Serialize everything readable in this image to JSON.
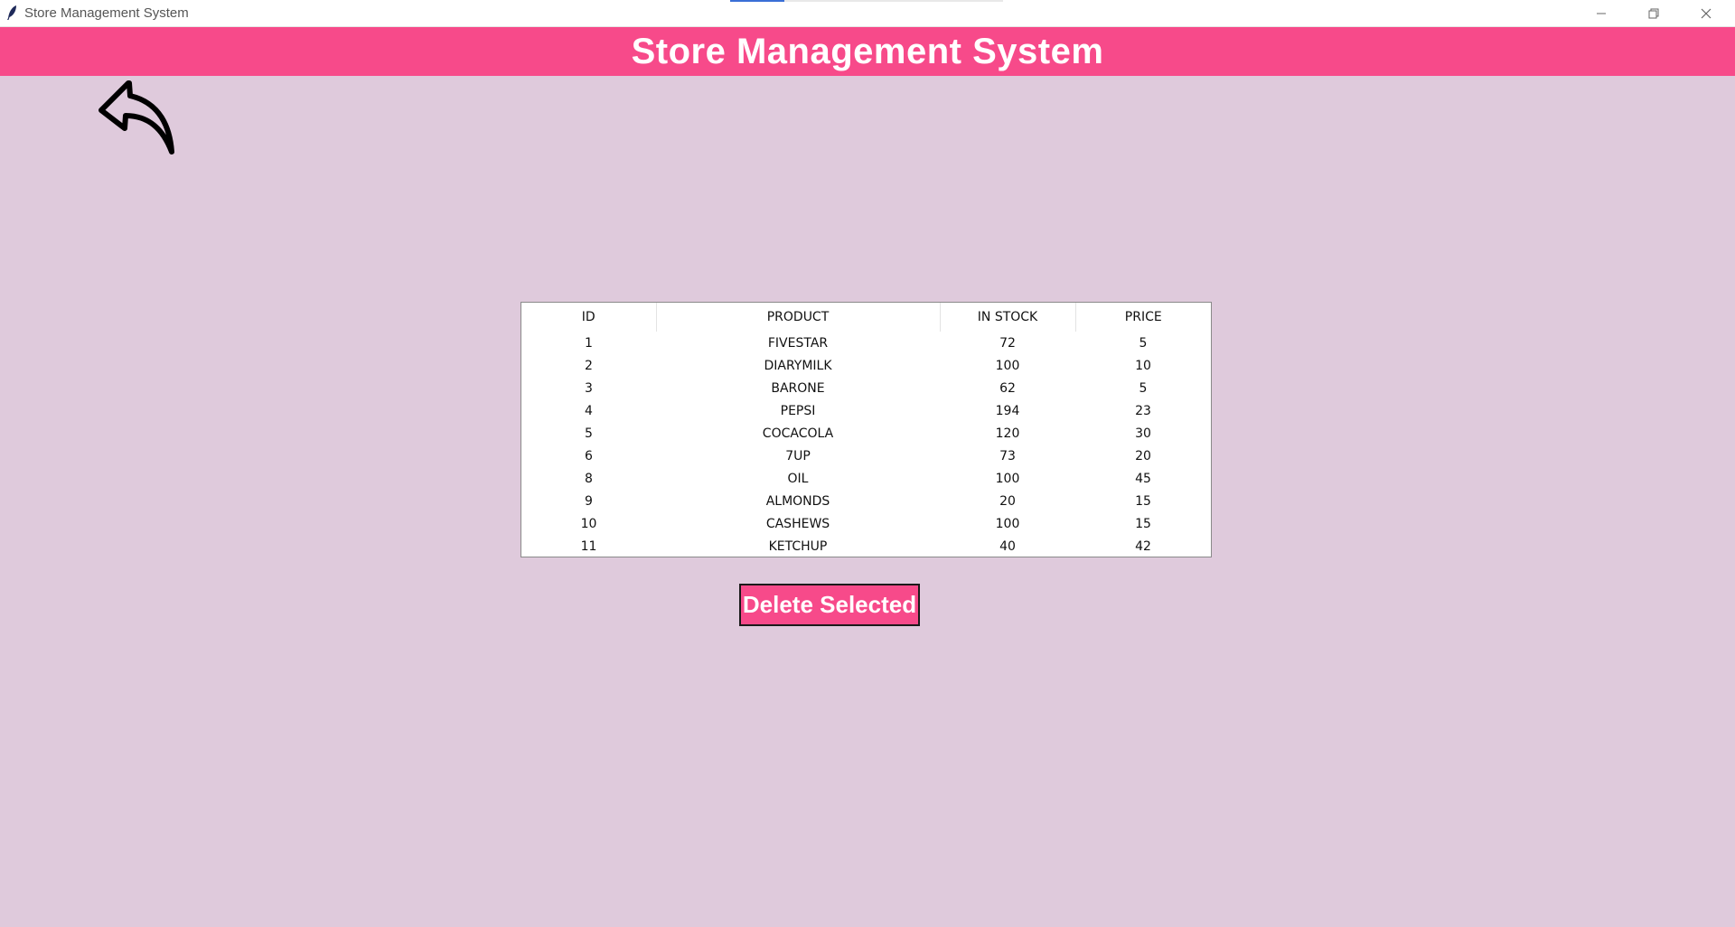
{
  "window": {
    "title": "Store Management System"
  },
  "header": {
    "title": "Store Management System"
  },
  "table": {
    "columns": [
      "ID",
      "PRODUCT",
      "IN STOCK",
      "PRICE"
    ],
    "rows": [
      [
        "1",
        "FIVESTAR",
        "72",
        "5"
      ],
      [
        "2",
        "DIARYMILK",
        "100",
        "10"
      ],
      [
        "3",
        "BARONE",
        "62",
        "5"
      ],
      [
        "4",
        "PEPSI",
        "194",
        "23"
      ],
      [
        "5",
        "COCACOLA",
        "120",
        "30"
      ],
      [
        "6",
        "7UP",
        "73",
        "20"
      ],
      [
        "8",
        "OIL",
        "100",
        "45"
      ],
      [
        "9",
        "ALMONDS",
        "20",
        "15"
      ],
      [
        "10",
        "CASHEWS",
        "100",
        "15"
      ],
      [
        "11",
        "KETCHUP",
        "40",
        "42"
      ]
    ]
  },
  "actions": {
    "delete_label": "Delete Selected"
  },
  "icons": {
    "back": "back-arrow-icon",
    "app": "feather-icon"
  },
  "colors": {
    "accent": "#f74a8a",
    "background": "#dfcadc"
  }
}
